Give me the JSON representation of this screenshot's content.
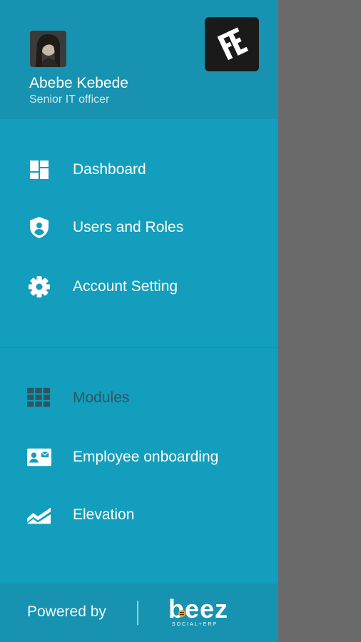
{
  "user": {
    "name": "Abebe Kebede",
    "role": "Senior IT officer"
  },
  "nav": {
    "dashboard": "Dashboard",
    "users_roles": "Users and Roles",
    "account_setting": "Account Setting",
    "modules": "Modules",
    "employee_onboarding": "Employee onboarding",
    "elevation": "Elevation"
  },
  "footer": {
    "powered_by": "Powered by",
    "brand": "beez",
    "brand_tagline": "SOCIAL+ERP"
  },
  "colors": {
    "drawer": "#139ebd",
    "header": "#1793b1",
    "scrim": "#6a6a6a",
    "muted_label": "#2e5662"
  }
}
